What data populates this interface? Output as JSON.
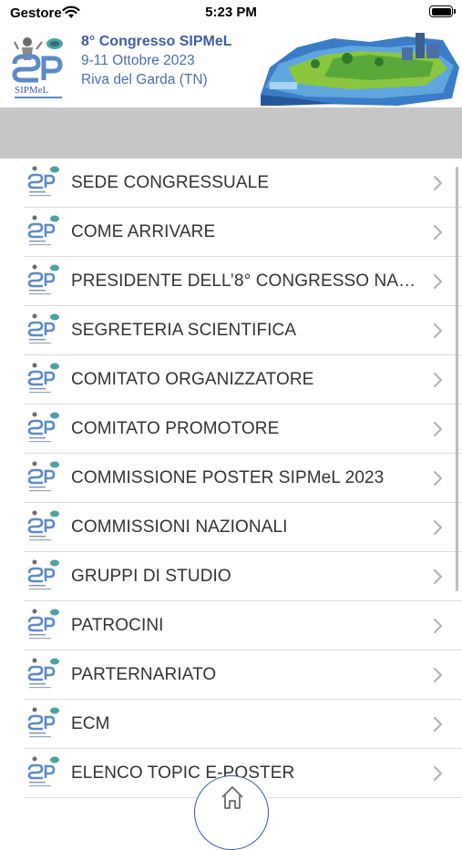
{
  "status_bar": {
    "carrier": "Gestore",
    "time": "5:23 PM"
  },
  "banner": {
    "logo_text": "SIPMeL",
    "title": "8° Congresso SIPMeL",
    "dates": "9-11 Ottobre 2023",
    "location": "Riva del Garda (TN)"
  },
  "list": {
    "items": [
      {
        "label": "SEDE CONGRESSUALE"
      },
      {
        "label": "COME ARRIVARE"
      },
      {
        "label": "PRESIDENTE DELL’8° CONGRESSO NAZIONALE"
      },
      {
        "label": "SEGRETERIA SCIENTIFICA"
      },
      {
        "label": "COMITATO ORGANIZZATORE"
      },
      {
        "label": "COMITATO PROMOTORE"
      },
      {
        "label": "COMMISSIONE POSTER SIPMeL 2023"
      },
      {
        "label": "COMMISSIONI NAZIONALI"
      },
      {
        "label": "GRUPPI DI STUDIO"
      },
      {
        "label": "PATROCINI"
      },
      {
        "label": "PARTERNARIATO"
      },
      {
        "label": "ECM"
      },
      {
        "label": "ELENCO TOPIC E-POSTER"
      }
    ]
  },
  "colors": {
    "accent": "#3f5ea0",
    "grey_bar": "#c7c7c7",
    "text": "#333333"
  },
  "icons": {
    "home": "home-icon",
    "row": "sipmel-logo-icon",
    "chevron": "chevron-right-icon"
  }
}
